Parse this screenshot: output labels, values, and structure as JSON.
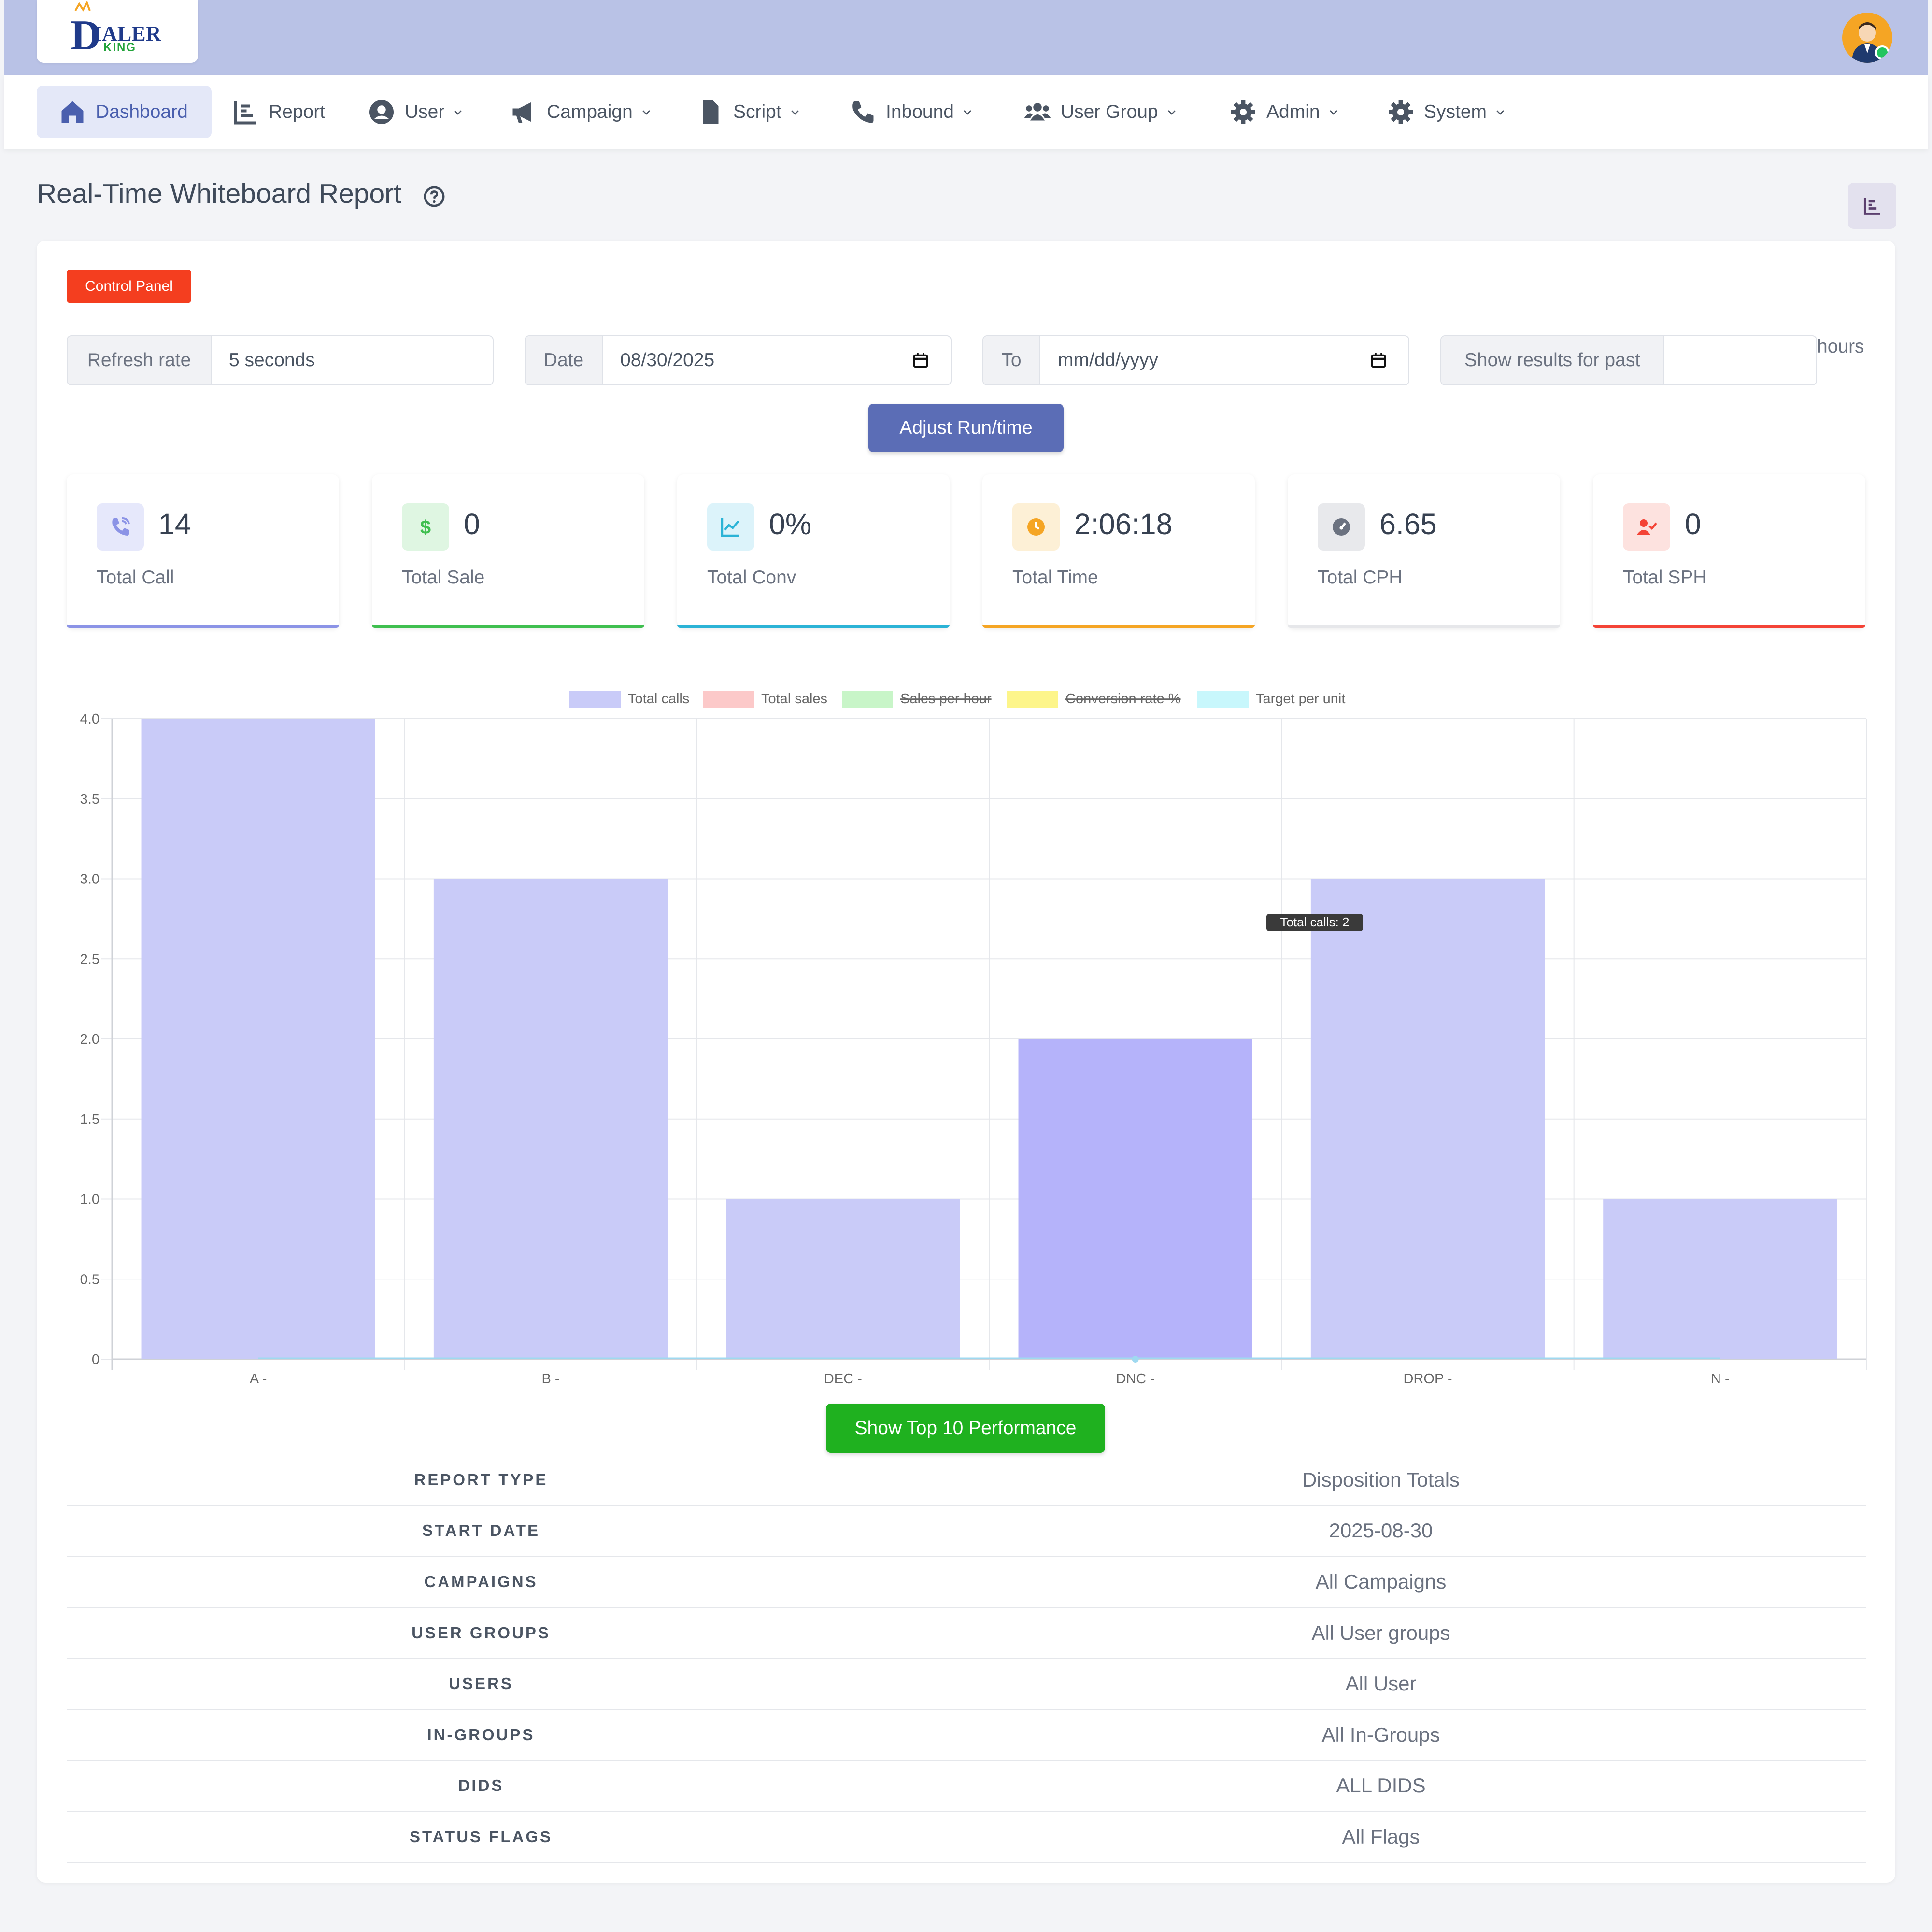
{
  "header": {
    "logo_text_main": "IALER",
    "logo_text_sub": "KING",
    "logo_text_d": "D"
  },
  "nav": {
    "items": [
      {
        "label": "Dashboard",
        "icon": "home-icon",
        "active": true
      },
      {
        "label": "Report",
        "icon": "chart-icon"
      },
      {
        "label": "User",
        "icon": "user-circle-icon",
        "dropdown": true
      },
      {
        "label": "Campaign",
        "icon": "megaphone-icon",
        "dropdown": true
      },
      {
        "label": "Script",
        "icon": "file-icon",
        "dropdown": true
      },
      {
        "label": "Inbound",
        "icon": "phone-icon",
        "dropdown": true
      },
      {
        "label": "User Group",
        "icon": "users-icon",
        "dropdown": true
      },
      {
        "label": "Admin",
        "icon": "gear-icon",
        "dropdown": true
      },
      {
        "label": "System",
        "icon": "gear-icon",
        "dropdown": true
      }
    ]
  },
  "page": {
    "title": "Real-Time Whiteboard Report"
  },
  "controls": {
    "control_panel_label": "Control Panel",
    "refresh_label": "Refresh rate",
    "refresh_value": "5 seconds",
    "date_label": "Date",
    "date_value": "08/30/2025",
    "to_label": "To",
    "to_placeholder": "mm/dd/yyyy",
    "past_label": "Show results for past",
    "past_value": "",
    "hours_label": "hours",
    "adjust_label": "Adjust Run/time"
  },
  "stats": [
    {
      "value": "14",
      "label": "Total Call",
      "icon": "phone-call-icon",
      "color": "#8b93e6",
      "bg": "#e6e8fb"
    },
    {
      "value": "0",
      "label": "Total Sale",
      "icon": "dollar-icon",
      "color": "#3fbf4f",
      "bg": "#dff6e2"
    },
    {
      "value": "0%",
      "label": "Total Conv",
      "icon": "trend-chart-icon",
      "color": "#2bb3d6",
      "bg": "#dcf3fa"
    },
    {
      "value": "2:06:18",
      "label": "Total Time",
      "icon": "clock-icon",
      "color": "#f5a524",
      "bg": "#fdf0d6"
    },
    {
      "value": "6.65",
      "label": "Total CPH",
      "icon": "gauge-icon",
      "color": "#6b7280",
      "bg": "#e8e9ec"
    },
    {
      "value": "0",
      "label": "Total SPH",
      "icon": "user-check-icon",
      "color": "#f44336",
      "bg": "#fde2df"
    }
  ],
  "chart_data": {
    "type": "bar",
    "categories": [
      "A -",
      "B -",
      "DEC -",
      "DNC -",
      "DROP -",
      "N -"
    ],
    "series": [
      {
        "name": "Total calls",
        "values": [
          4,
          3,
          1,
          2,
          3,
          1
        ],
        "color": "#c9cbf8",
        "hidden": false
      },
      {
        "name": "Total sales",
        "values": [
          0,
          0,
          0,
          0,
          0,
          0
        ],
        "color": "#fcc9c9",
        "hidden": false
      },
      {
        "name": "Sales per hour",
        "values": [],
        "color": "#c8f5c8",
        "hidden": true
      },
      {
        "name": "Conversion rate %",
        "values": [],
        "color": "#fdf58a",
        "hidden": true
      },
      {
        "name": "Target per unit",
        "values": [
          0,
          0,
          0,
          0,
          0,
          0
        ],
        "color": "#c8f7fc",
        "hidden": false
      }
    ],
    "ylim": [
      0,
      4.0
    ],
    "yticks": [
      "0",
      "0.5",
      "1.0",
      "1.5",
      "2.0",
      "2.5",
      "3.0",
      "3.5",
      "4.0"
    ],
    "grid": true,
    "legend": "top-center",
    "highlighted_index": 3,
    "highlight_color": "#b5b3fa",
    "tooltip": "Total calls: 2"
  },
  "top10_label": "Show Top 10 Performance",
  "summary": [
    {
      "key": "REPORT TYPE",
      "value": "Disposition Totals"
    },
    {
      "key": "START DATE",
      "value": "2025-08-30"
    },
    {
      "key": "CAMPAIGNS",
      "value": "All Campaigns"
    },
    {
      "key": "USER GROUPS",
      "value": "All User groups"
    },
    {
      "key": "USERS",
      "value": "All User"
    },
    {
      "key": "IN-GROUPS",
      "value": "All In-Groups"
    },
    {
      "key": "DIDS",
      "value": "ALL DIDS"
    },
    {
      "key": "STATUS FLAGS",
      "value": "All Flags"
    }
  ]
}
